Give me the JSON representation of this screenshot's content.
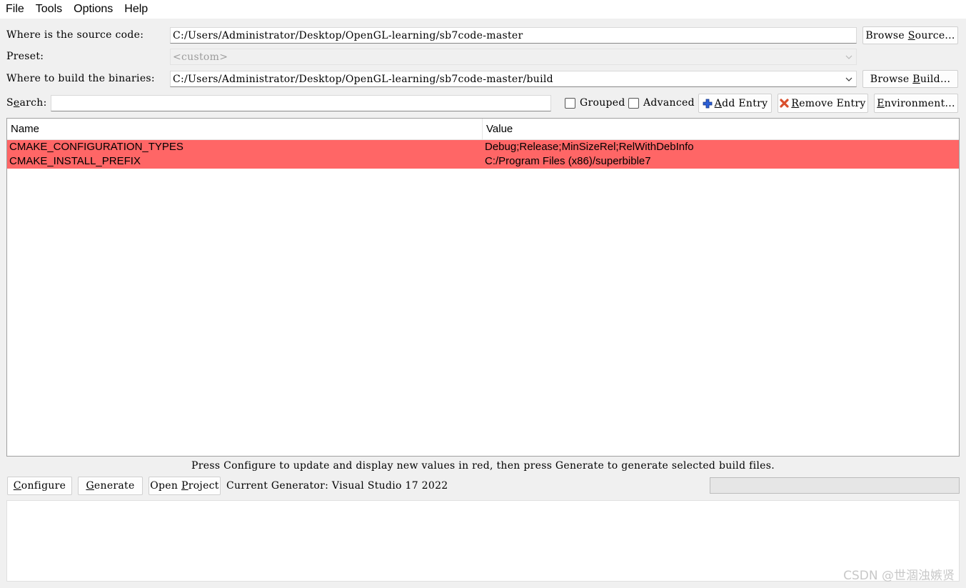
{
  "menu": [
    "File",
    "Tools",
    "Options",
    "Help"
  ],
  "source": {
    "label": "Where is the source code:",
    "value": "C:/Users/Administrator/Desktop/OpenGL-learning/sb7code-master",
    "browse_pre": "Browse ",
    "browse_u": "S",
    "browse_post": "ource..."
  },
  "preset": {
    "label": "Preset:",
    "value": "<custom>"
  },
  "build": {
    "label": "Where to build the binaries:",
    "value": "C:/Users/Administrator/Desktop/OpenGL-learning/sb7code-master/build",
    "browse_pre": "Browse ",
    "browse_u": "B",
    "browse_post": "uild..."
  },
  "search": {
    "label_pre": "S",
    "label_u": "e",
    "label_post": "arch:",
    "value": ""
  },
  "options": {
    "grouped": {
      "label": "Grouped",
      "checked": false
    },
    "advanced": {
      "label": "Advanced",
      "checked": false
    }
  },
  "buttons": {
    "add_entry_u": "A",
    "add_entry_rest": "dd Entry",
    "remove_entry_u": "R",
    "remove_entry_rest": "emove Entry",
    "environment_u": "E",
    "environment_rest": "nvironment..."
  },
  "table": {
    "headers": {
      "name": "Name",
      "value": "Value"
    },
    "rows": [
      {
        "name": "CMAKE_CONFIGURATION_TYPES",
        "value": "Debug;Release;MinSizeRel;RelWithDebInfo"
      },
      {
        "name": "CMAKE_INSTALL_PREFIX",
        "value": "C:/Program Files (x86)/superbible7"
      }
    ],
    "highlight_color": "#ff6666"
  },
  "hint": "Press Configure to update and display new values in red, then press Generate to generate selected build files.",
  "bottom": {
    "configure_u": "C",
    "configure_rest": "onfigure",
    "generate_u": "G",
    "generate_rest": "enerate",
    "open_pre": "Open ",
    "open_u": "P",
    "open_post": "roject",
    "generator": "Current Generator: Visual Studio 17 2022"
  },
  "watermark": "CSDN @世涸浊嫉贤"
}
